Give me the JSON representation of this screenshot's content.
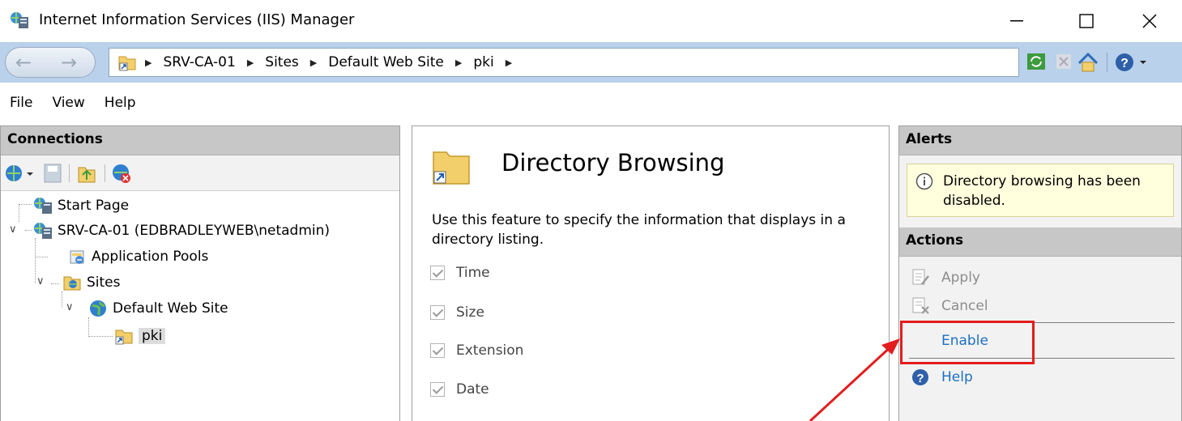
{
  "window": {
    "title": "Internet Information Services (IIS) Manager",
    "minimize": "—",
    "maximize": "☐",
    "close": "✕"
  },
  "address": {
    "crumbs": [
      "SRV-CA-01",
      "Sites",
      "Default Web Site",
      "pki"
    ],
    "separator": "▶"
  },
  "menu": [
    "File",
    "View",
    "Help"
  ],
  "connections": {
    "header": "Connections",
    "tree": [
      {
        "label": "Start Page",
        "icon": "iis-icon"
      },
      {
        "label": "SRV-CA-01 (EDBRADLEYWEB\\netadmin)",
        "icon": "server-icon"
      },
      {
        "label": "Application Pools",
        "icon": "app-pools-icon"
      },
      {
        "label": "Sites",
        "icon": "sites-folder-icon"
      },
      {
        "label": "Default Web Site",
        "icon": "globe-icon"
      },
      {
        "label": "pki",
        "icon": "virtual-folder-icon",
        "selected": true
      }
    ]
  },
  "feature": {
    "title": "Directory Browsing",
    "description": "Use this feature to specify the information that displays in a directory listing.",
    "options": [
      {
        "label": "Time",
        "checked": true
      },
      {
        "label": "Size",
        "checked": true
      },
      {
        "label": "Extension",
        "checked": true
      },
      {
        "label": "Date",
        "checked": true
      }
    ]
  },
  "alerts": {
    "header": "Alerts",
    "message": "Directory browsing has been disabled."
  },
  "actions": {
    "header": "Actions",
    "apply": "Apply",
    "cancel": "Cancel",
    "enable": "Enable",
    "help": "Help"
  },
  "colors": {
    "address_bar": "#b9d1ea",
    "panel_header": "#c7c7c7",
    "link": "#1d6fc2",
    "annotation": "#e21d1d"
  }
}
